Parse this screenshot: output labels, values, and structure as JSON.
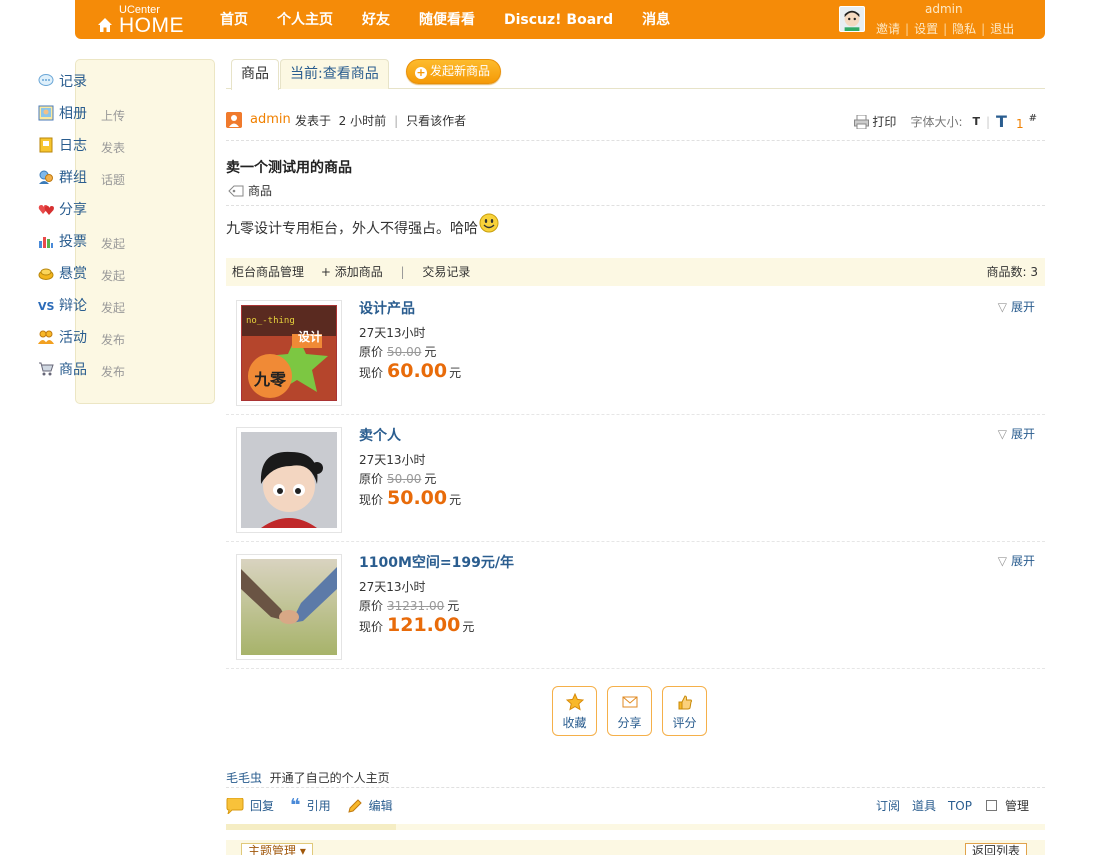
{
  "header": {
    "logo_small": "UCenter",
    "logo_big": "HOME",
    "nav": [
      "首页",
      "个人主页",
      "好友",
      "随便看看",
      "Discuz! Board",
      "消息"
    ],
    "username": "admin",
    "user_links": [
      "邀请",
      "设置",
      "隐私",
      "退出"
    ]
  },
  "sidebar": {
    "items": [
      {
        "label": "记录",
        "action": "",
        "icon": "speech-bubble-icon"
      },
      {
        "label": "相册",
        "action": "上传",
        "icon": "photo-icon"
      },
      {
        "label": "日志",
        "action": "发表",
        "icon": "notebook-icon"
      },
      {
        "label": "群组",
        "action": "话题",
        "icon": "group-icon"
      },
      {
        "label": "分享",
        "action": "",
        "icon": "hearts-icon"
      },
      {
        "label": "投票",
        "action": "发起",
        "icon": "bar-chart-icon"
      },
      {
        "label": "悬赏",
        "action": "发起",
        "icon": "gold-coin-icon"
      },
      {
        "label": "辩论",
        "action": "发起",
        "icon": "vs-icon"
      },
      {
        "label": "活动",
        "action": "发布",
        "icon": "people-icon"
      },
      {
        "label": "商品",
        "action": "发布",
        "icon": "cart-icon"
      }
    ]
  },
  "tabs": {
    "tab1": "商品",
    "tab2": "当前:查看商品",
    "new_button": "发起新商品"
  },
  "post": {
    "author": "admin",
    "posted": "发表于",
    "time": "2 小时前",
    "only_author": "只看该作者",
    "print": "打印",
    "font_size_label": "字体大小:",
    "font_small": "T",
    "font_big": "T",
    "floor": "1",
    "hash": "#",
    "title": "卖一个测试用的商品",
    "tag": "商品",
    "body": "九零设计专用柜台，外人不得强占。哈哈"
  },
  "goods_bar": {
    "manage": "柜台商品管理",
    "add": "+ 添加商品",
    "records": "交易记录",
    "count_label": "商品数: 3"
  },
  "goods": [
    {
      "name": "设计产品",
      "time": "27天13小时",
      "orig_label": "原价",
      "orig": "50.00",
      "now_label": "现价",
      "now": "60.00",
      "unit": "元",
      "expand": "展开"
    },
    {
      "name": "卖个人",
      "time": "27天13小时",
      "orig_label": "原价",
      "orig": "50.00",
      "now_label": "现价",
      "now": "50.00",
      "unit": "元",
      "expand": "展开"
    },
    {
      "name": "1100M空间=199元/年",
      "time": "27天13小时",
      "orig_label": "原价",
      "orig": "31231.00",
      "now_label": "现价",
      "now": "121.00",
      "unit": "元",
      "expand": "展开"
    }
  ],
  "thumb1_text": {
    "top": "no_-thing",
    "tag": "设计",
    "logo": "九零"
  },
  "actions": [
    "收藏",
    "分享",
    "评分"
  ],
  "activity": {
    "who": "毛毛虫",
    "text": "开通了自己的个人主页"
  },
  "reply_bar": {
    "reply": "回复",
    "quote": "引用",
    "edit": "编辑",
    "subscribe": "订阅",
    "tools": "道具",
    "top": "TOP",
    "manage": "管理"
  },
  "footer": {
    "topic_manage": "主题管理",
    "back_list": "返回列表"
  },
  "colors": {
    "header": "#f58b08",
    "link": "#2a5d8f",
    "price": "#e86b0a",
    "panel": "#fcf8e3"
  }
}
